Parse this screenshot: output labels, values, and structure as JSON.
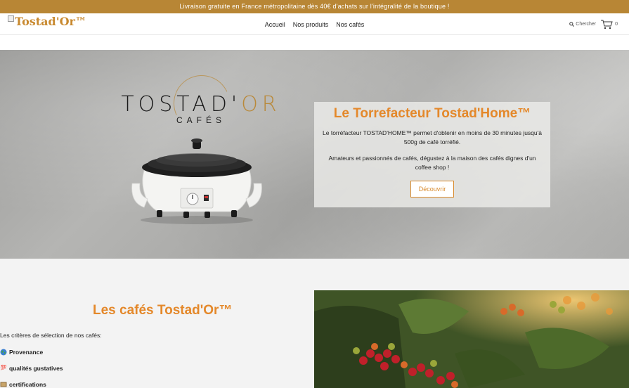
{
  "announcement": "Livraison gratuite en France métropolitaine dès 40€ d'achats sur l'intégralité de la boutique !",
  "header": {
    "logo_alt": "Tostad'Or™",
    "nav": [
      "Accueil",
      "Nos produits",
      "Nos cafés"
    ],
    "search_label": "Chercher",
    "cart_count": "0"
  },
  "hero": {
    "brand_name": "TOSTAD'OR",
    "brand_sub": "CAFÉS",
    "title": "Le Torrefacteur Tostad'Home™",
    "text1": "Le torréfacteur TOSTAD'HOME™ permet d'obtenir en moins de 30 minutes jusqu'à 500g de café torréfié.",
    "text2": "Amateurs et passionnés de cafés, dégustez à la maison des cafés dignes d'un coffee shop !",
    "button": "Découvrir"
  },
  "cafes": {
    "title": "Les cafés Tostad'Or™",
    "intro": "Les critères de sélection de nos cafés:",
    "criteria": [
      {
        "icon": "globe-icon",
        "label": "Provenance"
      },
      {
        "icon": "hundred-icon",
        "label": "qualités gustatives"
      },
      {
        "icon": "certificate-icon",
        "label": "certifications"
      }
    ]
  },
  "colors": {
    "accent": "#e4882a",
    "announcement_bg": "#b88635",
    "brand_gold": "#b9893a"
  }
}
